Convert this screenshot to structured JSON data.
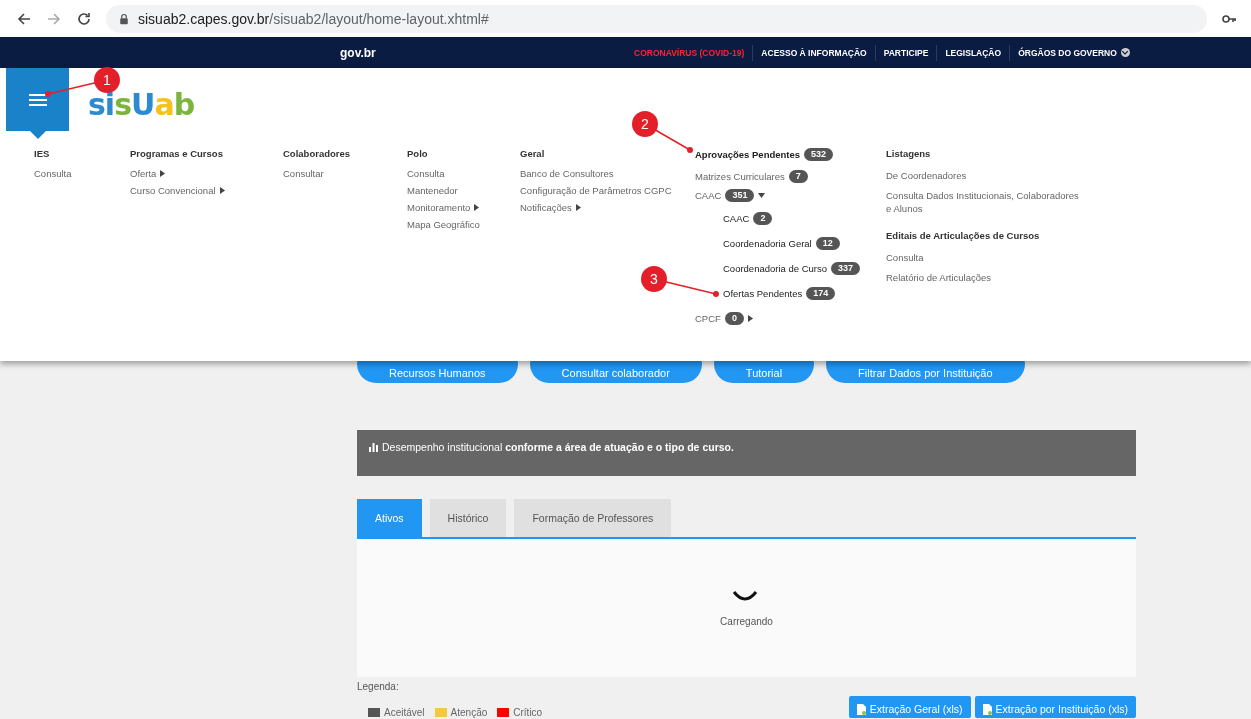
{
  "browser": {
    "url_domain": "sisuab2.capes.gov.br",
    "url_path": "/sisuab2/layout/home-layout.xhtml#"
  },
  "gov_bar": {
    "logo": "gov.br",
    "links": [
      {
        "label": "CORONAVÍRUS (COVID-19)",
        "kind": "alert"
      },
      {
        "label": "ACESSO À INFORMAÇÃO",
        "kind": "plain"
      },
      {
        "label": "PARTICIPE",
        "kind": "plain"
      },
      {
        "label": "LEGISLAÇÃO",
        "kind": "plain"
      },
      {
        "label": "ÓRGÃOS DO GOVERNO",
        "kind": "dropdown"
      }
    ]
  },
  "logo": "sisUab",
  "menu": {
    "columns": [
      {
        "title": "IES",
        "items": [
          {
            "label": "Consulta",
            "submenu": false
          }
        ]
      },
      {
        "title": "Programas e Cursos",
        "items": [
          {
            "label": "Oferta",
            "submenu": true
          },
          {
            "label": "Curso Convencional",
            "submenu": true
          }
        ]
      },
      {
        "title": "Colaboradores",
        "items": [
          {
            "label": "Consultar",
            "submenu": false
          }
        ]
      },
      {
        "title": "Polo",
        "items": [
          {
            "label": "Consulta",
            "submenu": false
          },
          {
            "label": "Mantenedor",
            "submenu": false
          },
          {
            "label": "Monitoramento",
            "submenu": true
          },
          {
            "label": "Mapa Geográfico",
            "submenu": false
          }
        ]
      },
      {
        "title": "Geral",
        "items": [
          {
            "label": "Banco de Consultores",
            "submenu": false
          },
          {
            "label": "Configuração de Parâmetros CGPC",
            "submenu": false
          },
          {
            "label": "Notificações",
            "submenu": true
          }
        ]
      }
    ],
    "approvals": {
      "title": "Aprovações Pendentes",
      "count": "532",
      "items": [
        {
          "label": "Matrizes Curriculares",
          "count": "7"
        },
        {
          "label": "CAAC",
          "count": "351",
          "expanded": true,
          "children": [
            {
              "label": "CAAC",
              "count": "2"
            },
            {
              "label": "Coordenadoria Geral",
              "count": "12"
            },
            {
              "label": "Coordenadoria de Curso",
              "count": "337"
            },
            {
              "label": "Ofertas Pendentes",
              "count": "174"
            }
          ]
        },
        {
          "label": "CPCF",
          "count": "0",
          "expanded": false
        }
      ]
    },
    "right_sections": [
      {
        "title": "Listagens",
        "items": [
          "De Coordenadores",
          "Consulta Dados Institucionais, Colaboradores e Alunos"
        ]
      },
      {
        "title": "Editais de Articulações de Cursos",
        "items": [
          "Consulta",
          "Relatório de Articulações"
        ]
      }
    ]
  },
  "annotations": [
    "1",
    "2",
    "3"
  ],
  "quick_buttons": [
    "Recursos Humanos",
    "Consultar colaborador",
    "Tutorial",
    "Filtrar Dados por Instituição"
  ],
  "banner": "Desempenho institucional **conforme a área de atuação e o tipo de curso.**",
  "tabs": [
    {
      "label": "Ativos",
      "selected": true
    },
    {
      "label": "Histórico",
      "selected": false
    },
    {
      "label": "Formação de Professores",
      "selected": false
    }
  ],
  "loading_text": "Carregando",
  "legend": {
    "title": "Legenda:",
    "items": [
      {
        "label": "Aceitável",
        "color": "#555555"
      },
      {
        "label": "Atenção",
        "color": "#f5c842"
      },
      {
        "label": "Crítico",
        "color": "#ff0000"
      }
    ]
  },
  "export_buttons": [
    "Extração Geral (xls)",
    "Extração por Instituição (xls)"
  ]
}
